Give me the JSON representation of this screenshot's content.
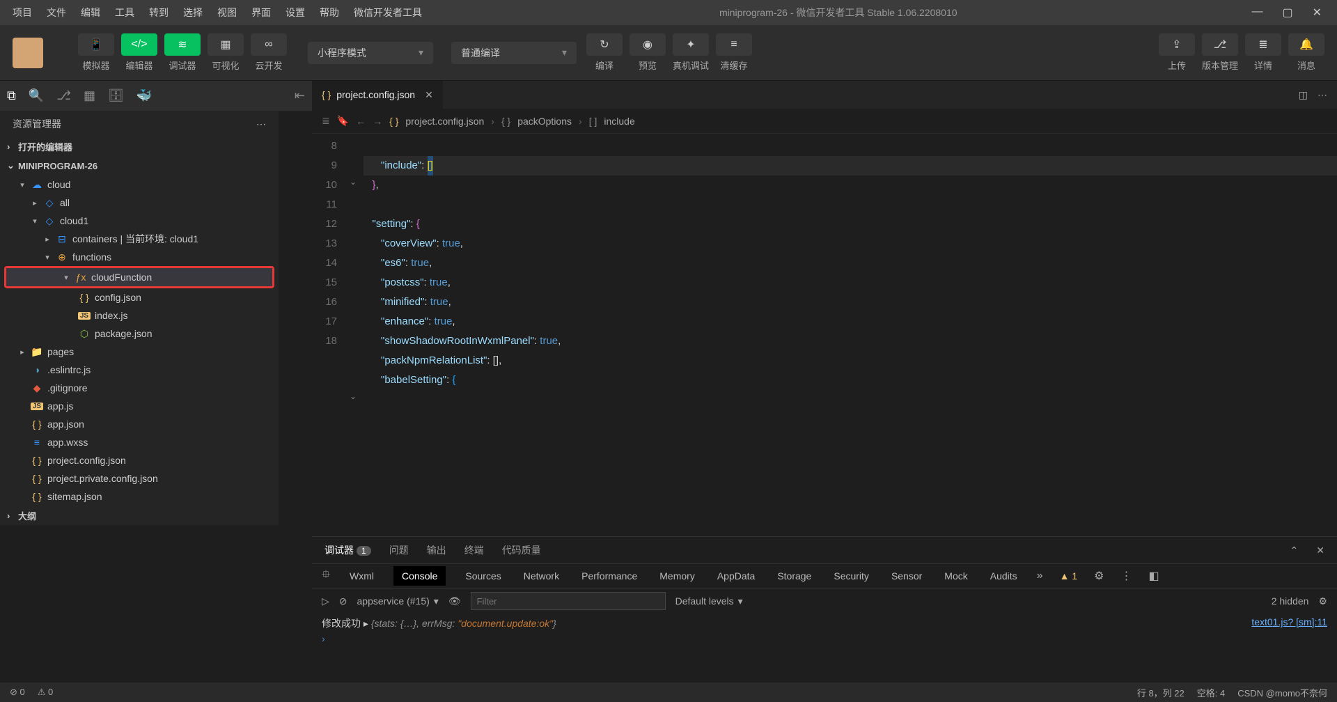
{
  "menus": [
    "项目",
    "文件",
    "编辑",
    "工具",
    "转到",
    "选择",
    "视图",
    "界面",
    "设置",
    "帮助",
    "微信开发者工具"
  ],
  "window_title": "miniprogram-26 - 微信开发者工具 Stable 1.06.2208010",
  "toolbar": {
    "simulator": "模拟器",
    "editor": "编辑器",
    "debugger": "调试器",
    "visual": "可视化",
    "clouddev": "云开发",
    "mode": "小程序模式",
    "compile_mode": "普通编译",
    "compile": "编译",
    "preview": "预览",
    "realdev": "真机调试",
    "clear": "清缓存",
    "upload": "上传",
    "version": "版本管理",
    "detail": "详情",
    "message": "消息"
  },
  "sidebar": {
    "title": "资源管理器",
    "open_editors": "打开的编辑器",
    "project": "MINIPROGRAM-26",
    "outline": "大纲",
    "tree": {
      "cloud": "cloud",
      "all": "all",
      "cloud1": "cloud1",
      "containers": "containers | 当前环境: cloud1",
      "functions": "functions",
      "cloudFunction": "cloudFunction",
      "config": "config.json",
      "index": "index.js",
      "package": "package.json",
      "pages": "pages",
      "eslint": ".eslintrc.js",
      "gitignore": ".gitignore",
      "appjs": "app.js",
      "appjson": "app.json",
      "appwxss": "app.wxss",
      "projconf": "project.config.json",
      "projpriv": "project.private.config.json",
      "sitemap": "sitemap.json"
    }
  },
  "tabs": {
    "file": "project.config.json"
  },
  "crumbs": {
    "file": "project.config.json",
    "obj": "packOptions",
    "arr": "include"
  },
  "code": {
    "lines": [
      "8",
      "9",
      "10",
      "11",
      "12",
      "13",
      "14",
      "15",
      "16",
      "17",
      "18"
    ],
    "l8a": "\"include\"",
    "l8b": ": ",
    "l8c": "[]",
    "l9": "},",
    "l10a": "\"setting\"",
    "l10b": ": ",
    "l10c": "{",
    "l11a": "\"coverView\"",
    "l11b": ": ",
    "l11c": "true",
    "l11d": ",",
    "l12a": "\"es6\"",
    "l12b": ": ",
    "l12c": "true",
    "l12d": ",",
    "l13a": "\"postcss\"",
    "l13b": ": ",
    "l13c": "true",
    "l13d": ",",
    "l14a": "\"minified\"",
    "l14b": ": ",
    "l14c": "true",
    "l14d": ",",
    "l15a": "\"enhance\"",
    "l15b": ": ",
    "l15c": "true",
    "l15d": ",",
    "l16a": "\"showShadowRootInWxmlPanel\"",
    "l16b": ": ",
    "l16c": "true",
    "l16d": ",",
    "l17a": "\"packNpmRelationList\"",
    "l17b": ": [],",
    "l18a": "\"babelSetting\"",
    "l18b": ": ",
    "l18c": "{"
  },
  "panel": {
    "tabs": {
      "debug": "调试器",
      "debug_badge": "1",
      "issues": "问题",
      "output": "输出",
      "terminal": "终端",
      "quality": "代码质量"
    },
    "devtabs": {
      "wxml": "Wxml",
      "console": "Console",
      "sources": "Sources",
      "network": "Network",
      "performance": "Performance",
      "memory": "Memory",
      "appdata": "AppData",
      "storage": "Storage",
      "security": "Security",
      "sensor": "Sensor",
      "mock": "Mock",
      "audits": "Audits",
      "warn": "1"
    },
    "console": {
      "context": "appservice (#15)",
      "filter_ph": "Filter",
      "levels": "Default levels",
      "hidden": "2 hidden",
      "msg": "修改成功",
      "obj_open": "{stats: {…}, errMsg: ",
      "doc": "\"document.update:ok\"",
      "obj_close": "}",
      "src": "text01.js? [sm]:11"
    }
  },
  "status": {
    "err": "0",
    "warn": "0",
    "pos": "行 8，列 22",
    "spaces": "空格: 4",
    "watermark": "CSDN @momo不奈何"
  }
}
